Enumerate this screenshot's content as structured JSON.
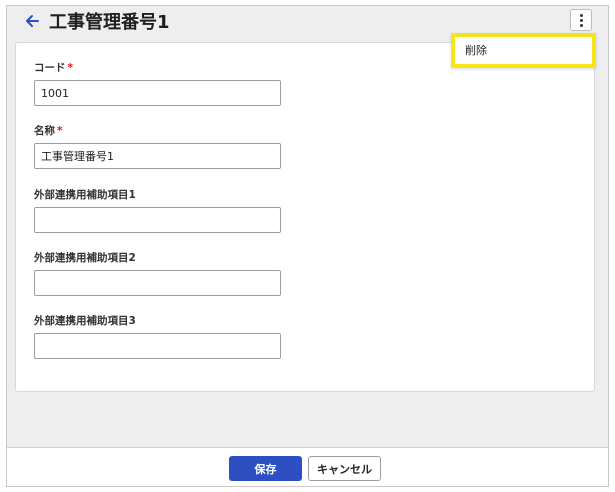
{
  "header": {
    "title": "工事管理番号1",
    "back_icon": "arrow-left-icon",
    "menu_icon": "kebab-menu-icon"
  },
  "menu": {
    "items": [
      {
        "label": "削除"
      }
    ]
  },
  "form": {
    "fields": [
      {
        "label": "コード",
        "required": true,
        "value": "1001"
      },
      {
        "label": "名称",
        "required": true,
        "value": "工事管理番号1"
      },
      {
        "label": "外部連携用補助項目1",
        "required": false,
        "value": ""
      },
      {
        "label": "外部連携用補助項目2",
        "required": false,
        "value": ""
      },
      {
        "label": "外部連携用補助項目3",
        "required": false,
        "value": ""
      }
    ],
    "required_mark": "*"
  },
  "footer": {
    "save_label": "保存",
    "cancel_label": "キャンセル"
  },
  "colors": {
    "accent": "#2d4fc1",
    "highlight": "#f5e61b",
    "required": "#d01b1b"
  }
}
